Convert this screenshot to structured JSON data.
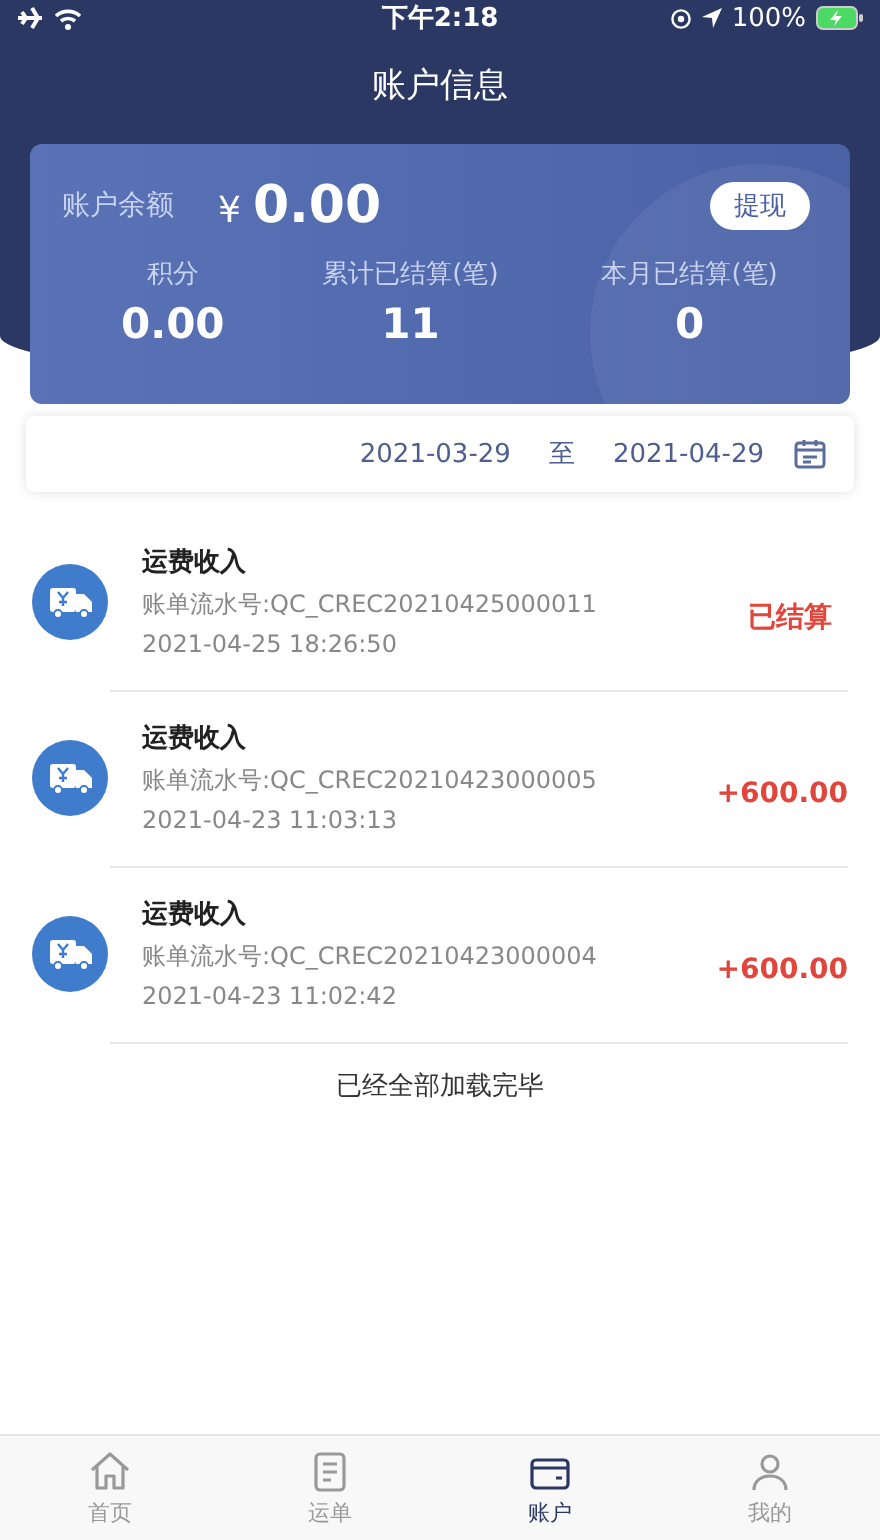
{
  "status_bar": {
    "time": "下午2:18",
    "battery": "100%"
  },
  "header": {
    "title": "账户信息"
  },
  "balance_card": {
    "label": "账户余额",
    "currency": "¥",
    "amount": "0.00",
    "withdraw_button": "提现",
    "stats": [
      {
        "label": "积分",
        "value": "0.00"
      },
      {
        "label": "累计已结算(笔)",
        "value": "11"
      },
      {
        "label": "本月已结算(笔)",
        "value": "0"
      }
    ]
  },
  "date_range": {
    "start": "2021-03-29",
    "separator": "至",
    "end": "2021-04-29"
  },
  "transactions": [
    {
      "title": "运费收入",
      "serial": "账单流水号:QC_CREC20210425000011",
      "time": "2021-04-25 18:26:50",
      "kind": "status",
      "result": "已结算"
    },
    {
      "title": "运费收入",
      "serial": "账单流水号:QC_CREC20210423000005",
      "time": "2021-04-23 11:03:13",
      "kind": "amount",
      "result": "+600.00"
    },
    {
      "title": "运费收入",
      "serial": "账单流水号:QC_CREC20210423000004",
      "time": "2021-04-23 11:02:42",
      "kind": "amount",
      "result": "+600.00"
    }
  ],
  "list_footer": "已经全部加载完毕",
  "tab_bar": [
    {
      "label": "首页",
      "selected": false
    },
    {
      "label": "运单",
      "selected": false
    },
    {
      "label": "账户",
      "selected": true
    },
    {
      "label": "我的",
      "selected": false
    }
  ]
}
